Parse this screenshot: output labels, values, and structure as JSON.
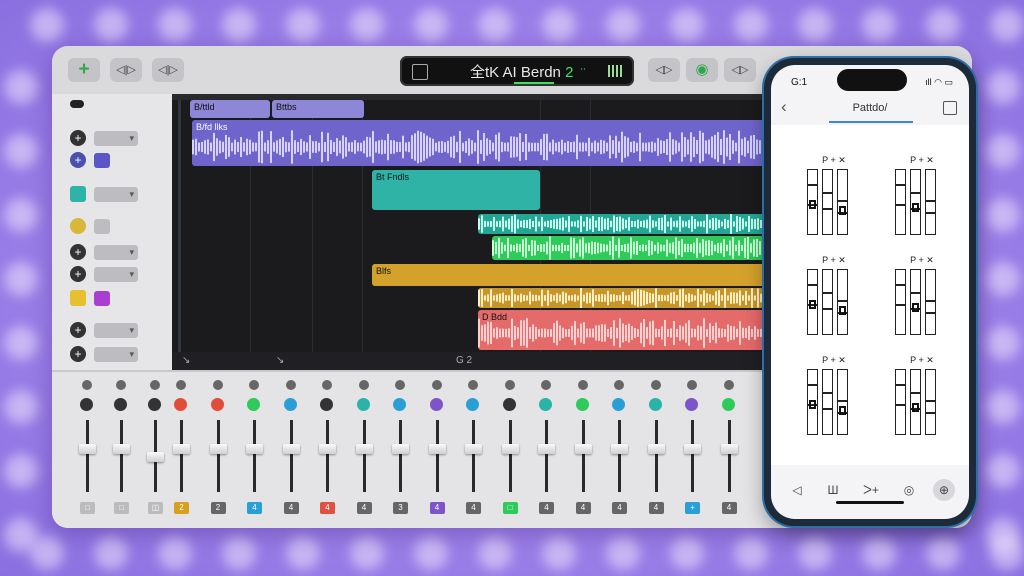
{
  "topbar": {
    "add_label": "+",
    "btn2_label": "◁|▷",
    "btn3_label": "◁|▷",
    "lcd_title": "全tK AI Berdn",
    "lcd_number": "2",
    "lcd_indicator": "ᐧ᠎ᐧ",
    "right_btn1": "◁▷",
    "right_btn2": "◉",
    "right_btn3": "◁▷"
  },
  "tracks": {
    "region_labels": [
      "B/ttld",
      "Bttbs",
      "B/fd llks",
      "Bt Fndls",
      "Blfs",
      "D Bdd"
    ],
    "bottom_marks": [
      "↘",
      "↘",
      "G 2"
    ]
  },
  "mixer": {
    "chip_labels": [
      "□",
      "□",
      "◫",
      "2",
      "2",
      "4",
      "4",
      "4",
      "4",
      "3",
      "4",
      "4",
      "□",
      "4",
      "4",
      "4",
      "4",
      "+",
      "4"
    ]
  },
  "phone": {
    "time": "G:1",
    "status_right": "ıll ◠ ▭",
    "title": "Pattdo/",
    "cells": [
      {
        "label": "P  +  ✕"
      },
      {
        "label": "P  +  ✕"
      },
      {
        "label": "P  +  ✕"
      },
      {
        "label": "P  +  ✕"
      },
      {
        "label": "P  +  ✕"
      },
      {
        "label": "P  +  ✕"
      }
    ],
    "tabs": [
      "◁",
      "Ш",
      "ᐳ+",
      "◎",
      "⊕"
    ]
  },
  "colors": {
    "purple_region": "#7c6fd8",
    "teal_region": "#2fb3a7",
    "green_region": "#2ecb5a",
    "gold_region": "#c9961f",
    "red_region": "#e56a6a",
    "lcd_green": "#3fe35b"
  }
}
